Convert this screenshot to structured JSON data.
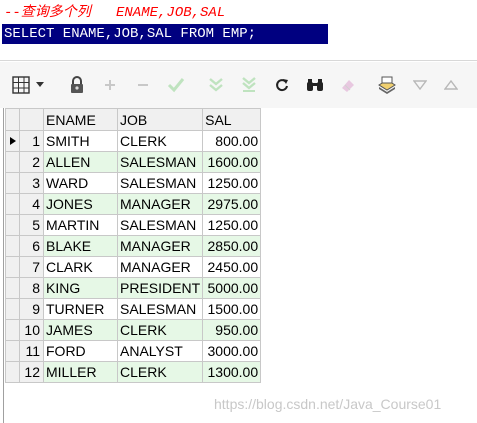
{
  "editor": {
    "comment_line": "--查询多个列   ENAME,JOB,SAL",
    "sql_line": "SELECT ENAME,JOB,SAL FROM EMP;"
  },
  "toolbar": {
    "buttons": [
      {
        "icon": "grid-icon",
        "enabled": true
      },
      {
        "icon": "dropdown-arrow-icon",
        "enabled": true
      },
      {
        "icon": "lock-icon",
        "enabled": true
      },
      {
        "icon": "plus-icon",
        "enabled": false
      },
      {
        "icon": "minus-icon",
        "enabled": false
      },
      {
        "icon": "check-icon",
        "enabled": false
      },
      {
        "icon": "double-chevron-down-icon",
        "enabled": false
      },
      {
        "icon": "double-chevron-down-line-icon",
        "enabled": false
      },
      {
        "icon": "refresh-icon",
        "enabled": true
      },
      {
        "icon": "binoculars-icon",
        "enabled": true
      },
      {
        "icon": "eraser-icon",
        "enabled": false
      },
      {
        "icon": "export-icon",
        "enabled": true
      },
      {
        "icon": "triangle-down-icon",
        "enabled": false
      },
      {
        "icon": "triangle-up-icon",
        "enabled": false
      }
    ]
  },
  "grid": {
    "columns": [
      "ENAME",
      "JOB",
      "SAL"
    ],
    "current_row": 1,
    "rows": [
      {
        "n": "1",
        "ename": "SMITH",
        "job": "CLERK",
        "sal": "800.00"
      },
      {
        "n": "2",
        "ename": "ALLEN",
        "job": "SALESMAN",
        "sal": "1600.00"
      },
      {
        "n": "3",
        "ename": "WARD",
        "job": "SALESMAN",
        "sal": "1250.00"
      },
      {
        "n": "4",
        "ename": "JONES",
        "job": "MANAGER",
        "sal": "2975.00"
      },
      {
        "n": "5",
        "ename": "MARTIN",
        "job": "SALESMAN",
        "sal": "1250.00"
      },
      {
        "n": "6",
        "ename": "BLAKE",
        "job": "MANAGER",
        "sal": "2850.00"
      },
      {
        "n": "7",
        "ename": "CLARK",
        "job": "MANAGER",
        "sal": "2450.00"
      },
      {
        "n": "8",
        "ename": "KING",
        "job": "PRESIDENT",
        "sal": "5000.00"
      },
      {
        "n": "9",
        "ename": "TURNER",
        "job": "SALESMAN",
        "sal": "1500.00"
      },
      {
        "n": "10",
        "ename": "JAMES",
        "job": "CLERK",
        "sal": "950.00"
      },
      {
        "n": "11",
        "ename": "FORD",
        "job": "ANALYST",
        "sal": "3000.00"
      },
      {
        "n": "12",
        "ename": "MILLER",
        "job": "CLERK",
        "sal": "1300.00"
      }
    ]
  },
  "watermark": "https://blog.csdn.net/Java_Course01",
  "colors": {
    "comment": "#ff0000",
    "selection_bg": "#000080",
    "alt_row": "#e6f8e6"
  }
}
